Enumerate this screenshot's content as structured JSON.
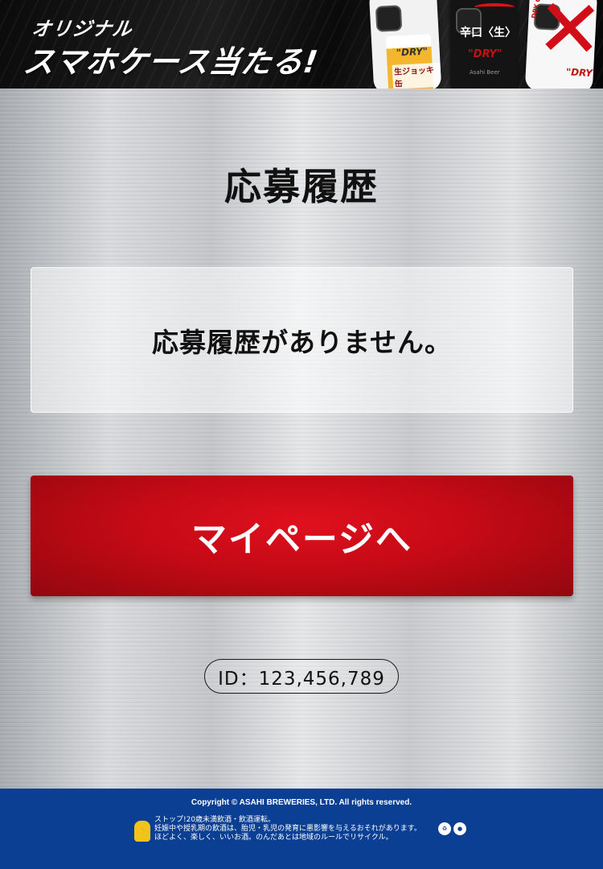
{
  "banner": {
    "subtitle": "オリジナル",
    "title": "スマホケース当たる!",
    "cases": [
      {
        "label": "\"DRY\"",
        "sub": "生ジョッキ缶"
      },
      {
        "label": "辛口〈生〉",
        "brand": "\"DRY\"",
        "maker": "Asahi Beer"
      },
      {
        "side": "DRY CRYSTAL",
        "brand": "\"DRY\""
      }
    ]
  },
  "main": {
    "title": "応募履歴",
    "empty_message": "応募履歴がありません。",
    "mypage_button": "マイページへ",
    "user_id": "ID：123,456,789"
  },
  "footer": {
    "copyright": "Copyright © ASAHI BREWERIES, LTD. All rights reserved.",
    "warning_lines": [
      "ストップ!20歳未満飲酒・飲酒運転。",
      "妊娠中や授乳期の飲酒は、胎児・乳児の発育に悪影響を与えるおそれがあります。",
      "ほどよく、楽しく、いいお酒。のんだあとは地域のルールでリサイクル。"
    ],
    "colors": {
      "background": "#0a3f93"
    }
  }
}
